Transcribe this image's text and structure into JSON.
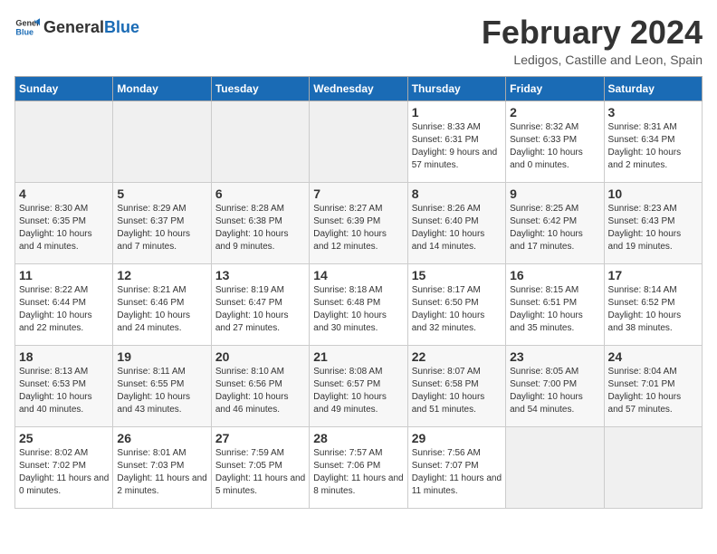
{
  "header": {
    "logo_general": "General",
    "logo_blue": "Blue",
    "title": "February 2024",
    "subtitle": "Ledigos, Castille and Leon, Spain"
  },
  "days_of_week": [
    "Sunday",
    "Monday",
    "Tuesday",
    "Wednesday",
    "Thursday",
    "Friday",
    "Saturday"
  ],
  "weeks": [
    {
      "days": [
        {
          "number": "",
          "info": "",
          "empty": true
        },
        {
          "number": "",
          "info": "",
          "empty": true
        },
        {
          "number": "",
          "info": "",
          "empty": true
        },
        {
          "number": "",
          "info": "",
          "empty": true
        },
        {
          "number": "1",
          "info": "Sunrise: 8:33 AM\nSunset: 6:31 PM\nDaylight: 9 hours and 57 minutes."
        },
        {
          "number": "2",
          "info": "Sunrise: 8:32 AM\nSunset: 6:33 PM\nDaylight: 10 hours and 0 minutes."
        },
        {
          "number": "3",
          "info": "Sunrise: 8:31 AM\nSunset: 6:34 PM\nDaylight: 10 hours and 2 minutes."
        }
      ]
    },
    {
      "days": [
        {
          "number": "4",
          "info": "Sunrise: 8:30 AM\nSunset: 6:35 PM\nDaylight: 10 hours and 4 minutes."
        },
        {
          "number": "5",
          "info": "Sunrise: 8:29 AM\nSunset: 6:37 PM\nDaylight: 10 hours and 7 minutes."
        },
        {
          "number": "6",
          "info": "Sunrise: 8:28 AM\nSunset: 6:38 PM\nDaylight: 10 hours and 9 minutes."
        },
        {
          "number": "7",
          "info": "Sunrise: 8:27 AM\nSunset: 6:39 PM\nDaylight: 10 hours and 12 minutes."
        },
        {
          "number": "8",
          "info": "Sunrise: 8:26 AM\nSunset: 6:40 PM\nDaylight: 10 hours and 14 minutes."
        },
        {
          "number": "9",
          "info": "Sunrise: 8:25 AM\nSunset: 6:42 PM\nDaylight: 10 hours and 17 minutes."
        },
        {
          "number": "10",
          "info": "Sunrise: 8:23 AM\nSunset: 6:43 PM\nDaylight: 10 hours and 19 minutes."
        }
      ]
    },
    {
      "days": [
        {
          "number": "11",
          "info": "Sunrise: 8:22 AM\nSunset: 6:44 PM\nDaylight: 10 hours and 22 minutes."
        },
        {
          "number": "12",
          "info": "Sunrise: 8:21 AM\nSunset: 6:46 PM\nDaylight: 10 hours and 24 minutes."
        },
        {
          "number": "13",
          "info": "Sunrise: 8:19 AM\nSunset: 6:47 PM\nDaylight: 10 hours and 27 minutes."
        },
        {
          "number": "14",
          "info": "Sunrise: 8:18 AM\nSunset: 6:48 PM\nDaylight: 10 hours and 30 minutes."
        },
        {
          "number": "15",
          "info": "Sunrise: 8:17 AM\nSunset: 6:50 PM\nDaylight: 10 hours and 32 minutes."
        },
        {
          "number": "16",
          "info": "Sunrise: 8:15 AM\nSunset: 6:51 PM\nDaylight: 10 hours and 35 minutes."
        },
        {
          "number": "17",
          "info": "Sunrise: 8:14 AM\nSunset: 6:52 PM\nDaylight: 10 hours and 38 minutes."
        }
      ]
    },
    {
      "days": [
        {
          "number": "18",
          "info": "Sunrise: 8:13 AM\nSunset: 6:53 PM\nDaylight: 10 hours and 40 minutes."
        },
        {
          "number": "19",
          "info": "Sunrise: 8:11 AM\nSunset: 6:55 PM\nDaylight: 10 hours and 43 minutes."
        },
        {
          "number": "20",
          "info": "Sunrise: 8:10 AM\nSunset: 6:56 PM\nDaylight: 10 hours and 46 minutes."
        },
        {
          "number": "21",
          "info": "Sunrise: 8:08 AM\nSunset: 6:57 PM\nDaylight: 10 hours and 49 minutes."
        },
        {
          "number": "22",
          "info": "Sunrise: 8:07 AM\nSunset: 6:58 PM\nDaylight: 10 hours and 51 minutes."
        },
        {
          "number": "23",
          "info": "Sunrise: 8:05 AM\nSunset: 7:00 PM\nDaylight: 10 hours and 54 minutes."
        },
        {
          "number": "24",
          "info": "Sunrise: 8:04 AM\nSunset: 7:01 PM\nDaylight: 10 hours and 57 minutes."
        }
      ]
    },
    {
      "days": [
        {
          "number": "25",
          "info": "Sunrise: 8:02 AM\nSunset: 7:02 PM\nDaylight: 11 hours and 0 minutes."
        },
        {
          "number": "26",
          "info": "Sunrise: 8:01 AM\nSunset: 7:03 PM\nDaylight: 11 hours and 2 minutes."
        },
        {
          "number": "27",
          "info": "Sunrise: 7:59 AM\nSunset: 7:05 PM\nDaylight: 11 hours and 5 minutes."
        },
        {
          "number": "28",
          "info": "Sunrise: 7:57 AM\nSunset: 7:06 PM\nDaylight: 11 hours and 8 minutes."
        },
        {
          "number": "29",
          "info": "Sunrise: 7:56 AM\nSunset: 7:07 PM\nDaylight: 11 hours and 11 minutes."
        },
        {
          "number": "",
          "info": "",
          "empty": true
        },
        {
          "number": "",
          "info": "",
          "empty": true
        }
      ]
    }
  ]
}
